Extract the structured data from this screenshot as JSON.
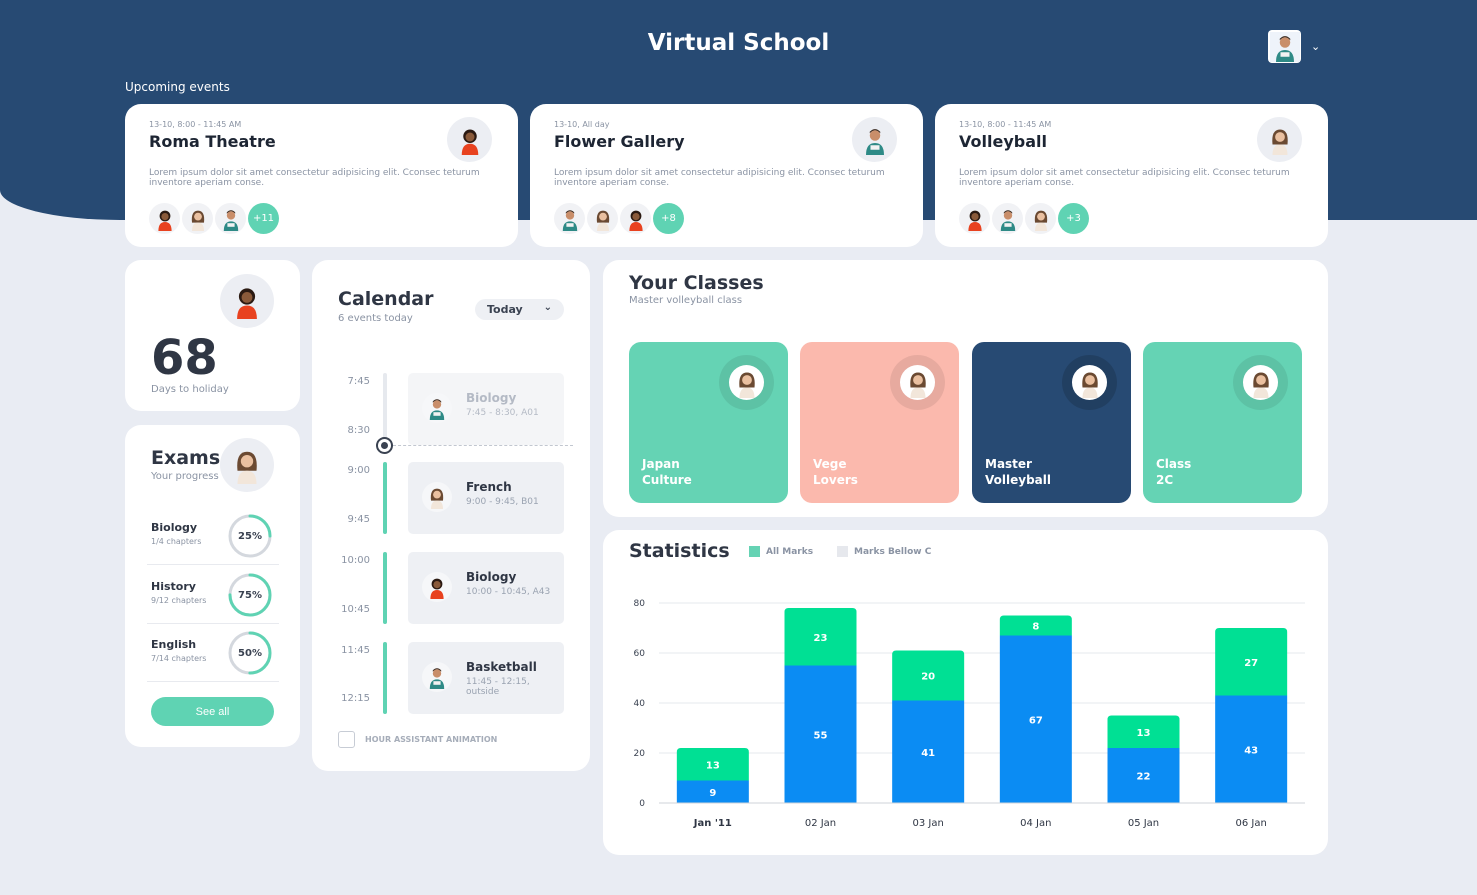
{
  "app": {
    "title": "Virtual School"
  },
  "header": {
    "upcoming_label": "Upcoming events"
  },
  "events": [
    {
      "time": "13-10, 8:00 - 11:45 AM",
      "title": "Roma Theatre",
      "desc": "Lorem ipsum dolor sit amet consectetur adipisicing elit. Cconsec teturum inventore aperiam conse.",
      "more": "+11"
    },
    {
      "time": "13-10, All day",
      "title": "Flower Gallery",
      "desc": "Lorem ipsum dolor sit amet consectetur adipisicing elit. Cconsec teturum inventore aperiam conse.",
      "more": "+8"
    },
    {
      "time": "13-10, 8:00 - 11:45 AM",
      "title": "Volleyball",
      "desc": "Lorem ipsum dolor sit amet consectetur adipisicing elit. Cconsec teturum inventore aperiam conse.",
      "more": "+3"
    }
  ],
  "holiday": {
    "days": "68",
    "label": "Days to holiday"
  },
  "exams": {
    "title": "Exams",
    "subtitle": "Your progress",
    "items": [
      {
        "name": "Biology",
        "chapters": "1/4 chapters",
        "progress": "25%",
        "fraction": 0.25
      },
      {
        "name": "History",
        "chapters": "9/12 chapters",
        "progress": "75%",
        "fraction": 0.75
      },
      {
        "name": "English",
        "chapters": "7/14 chapters",
        "progress": "50%",
        "fraction": 0.5
      }
    ],
    "see_all": "See all"
  },
  "calendar": {
    "title": "Calendar",
    "subtitle": "6 events today",
    "filter": "Today",
    "times": [
      "7:45",
      "8:30",
      "9:00",
      "9:45",
      "10:00",
      "10:45",
      "11:45",
      "12:15"
    ],
    "events": [
      {
        "name": "Biology",
        "time": "7:45 - 8:30, A01"
      },
      {
        "name": "French",
        "time": "9:00 - 9:45, B01"
      },
      {
        "name": "Biology",
        "time": "10:00 - 10:45, A43"
      },
      {
        "name": "Basketball",
        "time": "11:45 - 12:15, outside"
      }
    ],
    "assistant_label": "HOUR ASSISTANT ANIMATION"
  },
  "classes": {
    "title": "Your Classes",
    "subtitle": "Master volleyball class",
    "items": [
      {
        "name": "Japan\nCulture",
        "color": "#65d3b4"
      },
      {
        "name": "Vege\nLovers",
        "color": "#fbb9ad"
      },
      {
        "name": "Master\nVolleyball",
        "color": "#274a73"
      },
      {
        "name": "Class\n2C",
        "color": "#65d3b4"
      }
    ]
  },
  "statistics": {
    "title": "Statistics",
    "legend_all": "All Marks",
    "legend_below": "Marks Bellow C"
  },
  "chart_data": {
    "type": "bar",
    "stacked": true,
    "categories": [
      "Jan '11",
      "02 Jan",
      "03 Jan",
      "04 Jan",
      "05 Jan",
      "06 Jan"
    ],
    "series": [
      {
        "name": "",
        "values": [
          9,
          55,
          41,
          67,
          22,
          43
        ],
        "color": "#0b8cf3"
      },
      {
        "name": "",
        "values": [
          13,
          23,
          20,
          8,
          13,
          27
        ],
        "color": "#00e094"
      }
    ],
    "ylim": [
      0,
      80
    ],
    "yticks": [
      0,
      20,
      40,
      60,
      80
    ],
    "grid": true,
    "xlabel": "",
    "ylabel": ""
  }
}
